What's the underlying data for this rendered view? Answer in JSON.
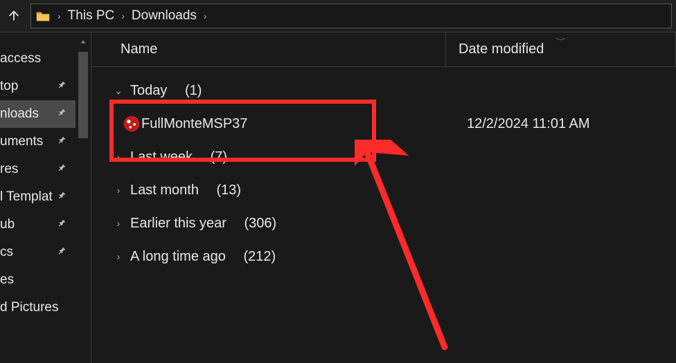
{
  "breadcrumb": {
    "loc1": "This PC",
    "loc2": "Downloads"
  },
  "sidebar": {
    "items": [
      {
        "label": "access",
        "pinned": false,
        "selected": false
      },
      {
        "label": "top",
        "pinned": true,
        "selected": false
      },
      {
        "label": "nloads",
        "pinned": true,
        "selected": true
      },
      {
        "label": "uments",
        "pinned": true,
        "selected": false
      },
      {
        "label": "res",
        "pinned": true,
        "selected": false
      },
      {
        "label": "l Templat",
        "pinned": true,
        "selected": false
      },
      {
        "label": "ub",
        "pinned": true,
        "selected": false
      },
      {
        "label": "cs",
        "pinned": true,
        "selected": false
      },
      {
        "label": "es",
        "pinned": false,
        "selected": false
      },
      {
        "label": "d Pictures",
        "pinned": false,
        "selected": false
      }
    ]
  },
  "columns": {
    "name": "Name",
    "date": "Date modified"
  },
  "groups": [
    {
      "label": "Today",
      "count": "(1)",
      "expanded": true
    },
    {
      "label": "Last week",
      "count": "(7)",
      "expanded": false
    },
    {
      "label": "Last month",
      "count": "(13)",
      "expanded": false
    },
    {
      "label": "Earlier this year",
      "count": "(306)",
      "expanded": false
    },
    {
      "label": "A long time ago",
      "count": "(212)",
      "expanded": false
    }
  ],
  "file": {
    "name": "FullMonteMSP37",
    "date": "12/2/2024 11:01 AM"
  }
}
